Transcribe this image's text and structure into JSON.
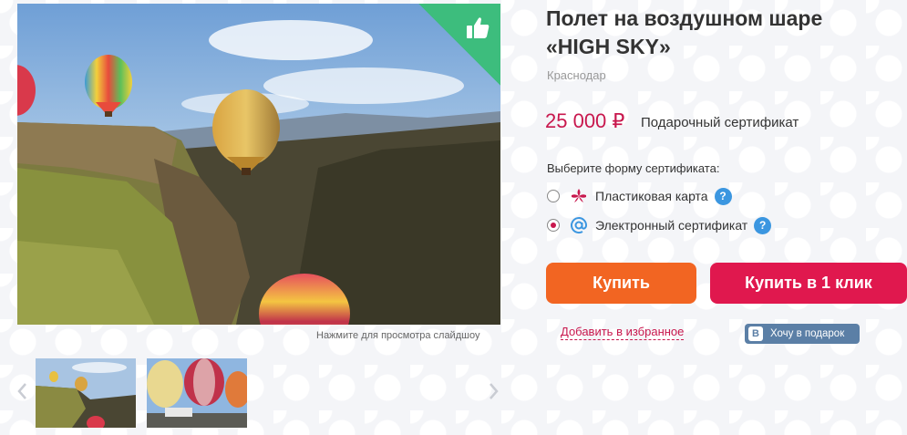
{
  "product": {
    "title": "Полет на воздушном шаре\n«HIGH SKY»",
    "city": "Краснодар",
    "price": "25 000 ₽",
    "price_type": "Подарочный сертификат"
  },
  "certificate_form": {
    "label": "Выберите форму сертификата:",
    "options": [
      {
        "label": "Пластиковая карта",
        "icon": "flower-icon",
        "selected": false,
        "help": "?"
      },
      {
        "label": "Электронный сертификат",
        "icon": "at-icon",
        "selected": true,
        "help": "?"
      }
    ]
  },
  "actions": {
    "buy_label": "Купить",
    "one_click_label": "Купить в 1 клик",
    "favorite_label": "Добавить в избранное",
    "vk_label": "Хочу в подарок",
    "vk_logo": "B"
  },
  "gallery": {
    "hint": "Нажмите для просмотра слайдшоу",
    "badge_icon": "thumbs-up-icon"
  },
  "colors": {
    "accent": "#c8174d",
    "buy": "#f26522",
    "one_click": "#e0184e",
    "badge": "#3dbd7d",
    "help": "#3b96e0",
    "vk": "#5b7fa6"
  }
}
